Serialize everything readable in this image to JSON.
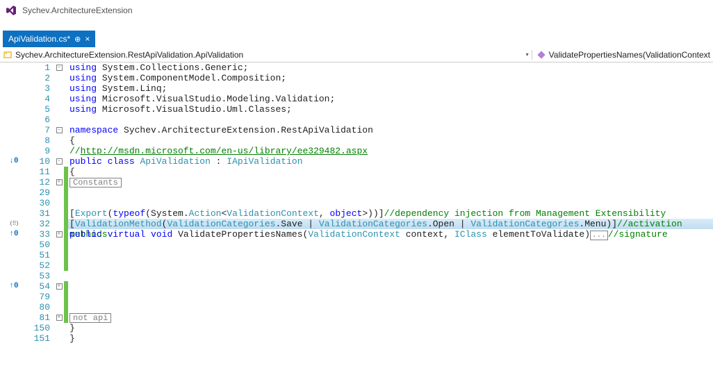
{
  "title": "Sychev.ArchitectureExtension",
  "tab": {
    "name": "ApiValidation.cs*",
    "modified": "*"
  },
  "nav": {
    "left": "Sychev.ArchitectureExtension.RestApiValidation.ApiValidation",
    "right": "ValidatePropertiesNames(ValidationContext"
  },
  "lines": {
    "l1": {
      "n": "1",
      "kw1": "using",
      "t": " System.Collections.Generic;"
    },
    "l2": {
      "n": "2",
      "kw1": "using",
      "t": " System.ComponentModel.Composition;"
    },
    "l3": {
      "n": "3",
      "kw1": "using",
      "t": " System.Linq;"
    },
    "l4": {
      "n": "4",
      "kw1": "using",
      "t": " Microsoft.VisualStudio.Modeling.Validation;"
    },
    "l5": {
      "n": "5",
      "kw1": "using",
      "t": " Microsoft.VisualStudio.Uml.Classes;"
    },
    "l6": {
      "n": "6"
    },
    "l7": {
      "n": "7",
      "kw1": "namespace",
      "t": " Sychev.ArchitectureExtension.RestApiValidation"
    },
    "l8": {
      "n": "8",
      "t": "{"
    },
    "l9": {
      "n": "9",
      "c": "//",
      "link": "http://msdn.microsoft.com/en-us/library/ee329482.aspx"
    },
    "l10": {
      "n": "10",
      "kw1": "public",
      "kw2": "class",
      "typ": "ApiValidation",
      "t2": " : ",
      "typ2": "IApiValidation"
    },
    "l11": {
      "n": "11",
      "t": "{"
    },
    "l12": {
      "n": "12",
      "region": "Constants"
    },
    "l29": {
      "n": "29"
    },
    "l30": {
      "n": "30"
    },
    "l31": {
      "n": "31"
    },
    "l32": {
      "n": "32"
    },
    "l33": {
      "n": "33"
    },
    "l50": {
      "n": "50"
    },
    "l51": {
      "n": "51"
    },
    "l52": {
      "n": "52"
    },
    "l53": {
      "n": "53"
    },
    "l54": {
      "n": "54"
    },
    "l79": {
      "n": "79"
    },
    "l80": {
      "n": "80"
    },
    "l81": {
      "n": "81",
      "region": "not api"
    },
    "l150": {
      "n": "150",
      "t": "}"
    },
    "l151": {
      "n": "151",
      "t": "}"
    }
  },
  "code31": {
    "p1": "[",
    "typ1": "Export",
    "p2": "(",
    "kw1": "typeof",
    "p3": "(System.",
    "typ2": "Action",
    "p4": "<",
    "typ3": "ValidationContext",
    "p5": ", ",
    "kw2": "object",
    "p6": ">))]",
    "cmt": "//dependency injection from Management Extensibility framework"
  },
  "code32": {
    "p1": "[",
    "typ1": "ValidationMethod",
    "p2": "(",
    "typ2": "ValidationCategories",
    "p3": ".Save | ",
    "typ3": "ValidationCategories",
    "p4": ".Open | ",
    "typ4": "ValidationCategories",
    "p5": ".Menu)]",
    "cmt": "//activation methods"
  },
  "code33": {
    "kw1": "public",
    "sp1": " ",
    "kw2": "virtual",
    "sp2": " ",
    "kw3": "void",
    "t1": " ValidatePropertiesNames(",
    "typ1": "ValidationContext",
    "t2": " context, ",
    "typ2": "IClass",
    "t3": " elementToValidate)",
    "coll": "...",
    "cmt": "//signature"
  },
  "glyphs": {
    "down0": "↓0",
    "up0": "↑0",
    "dotsbox": "(⠿)"
  }
}
